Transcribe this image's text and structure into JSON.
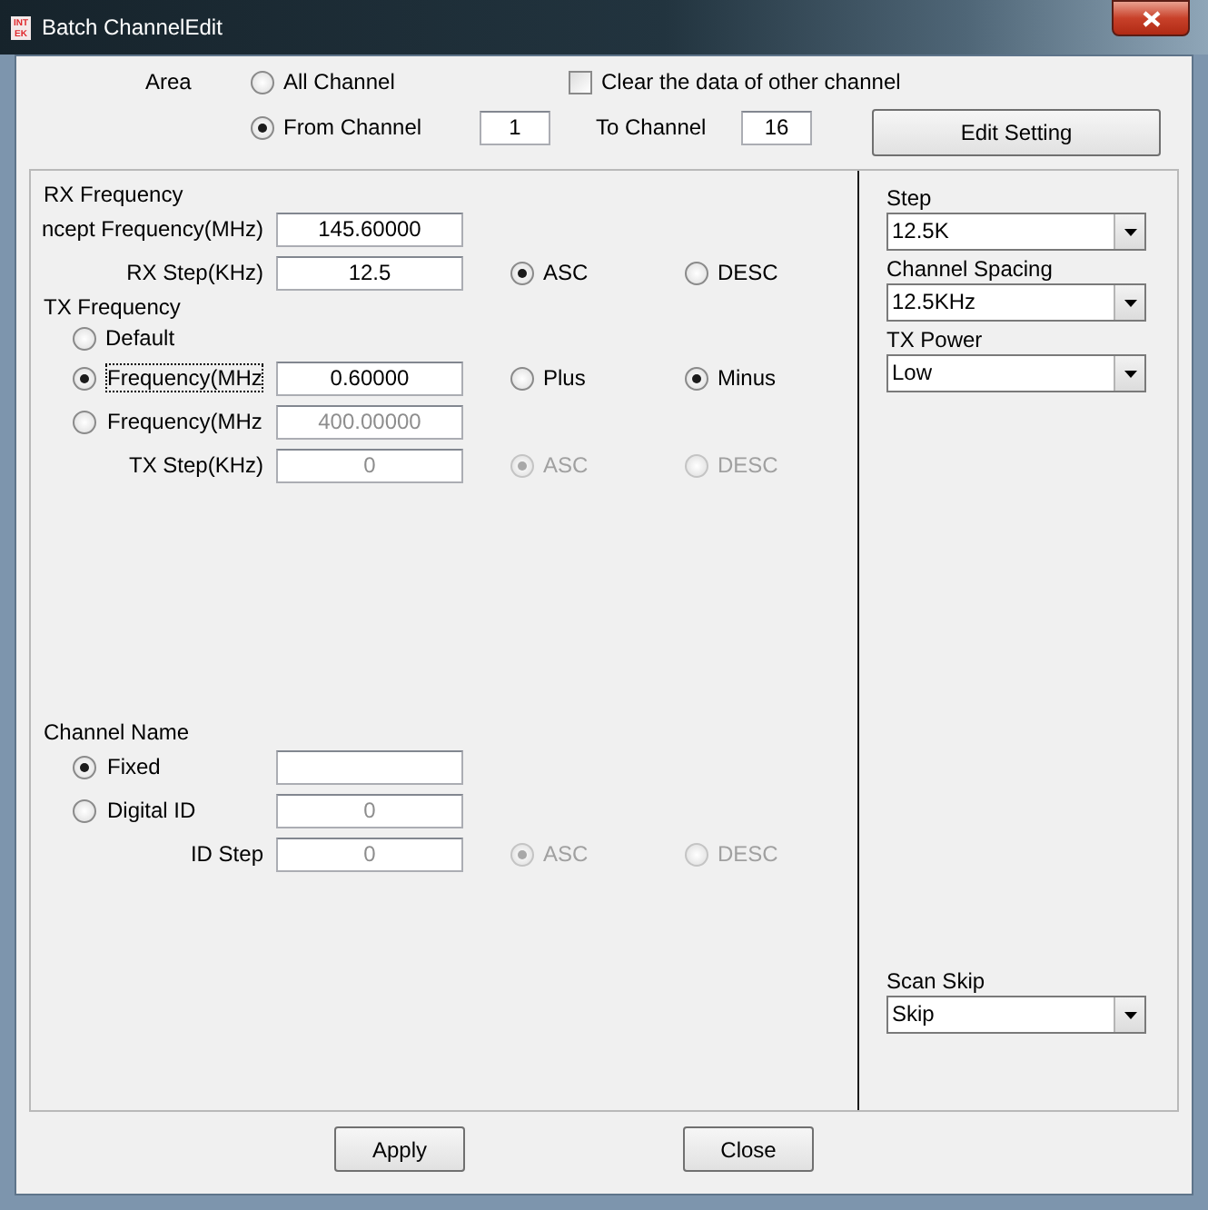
{
  "window": {
    "title": "Batch ChannelEdit",
    "icon_text": [
      "INT",
      "EK"
    ]
  },
  "area": {
    "label": "Area",
    "options": [
      {
        "label": "All Channel",
        "selected": false
      },
      {
        "label": "From Channel",
        "selected": true
      }
    ],
    "clear_other": {
      "label": "Clear the data of other channel",
      "checked": false
    },
    "from_value": "1",
    "to_label": "To Channel",
    "to_value": "16",
    "edit_button": "Edit Setting"
  },
  "sections": [
    {
      "rows": [
        {
          "kind": "heading",
          "text": "RX Frequency"
        },
        {
          "kind": "field",
          "label": "ncept Frequency(MHz)",
          "value": "145.60000",
          "disabled": false
        },
        {
          "kind": "field",
          "label": "RX Step(KHz)",
          "value": "12.5",
          "disabled": false,
          "options": [
            {
              "label": "ASC",
              "selected": true,
              "disabled": false
            },
            {
              "label": "DESC",
              "selected": false,
              "disabled": false
            }
          ]
        },
        {
          "kind": "heading",
          "text": "TX Frequency"
        },
        {
          "kind": "radio",
          "label": "Default",
          "selected": false
        },
        {
          "kind": "radio_field",
          "label": "Frequency(MHz",
          "selected": true,
          "focused": true,
          "value": "0.60000",
          "disabled": false,
          "options": [
            {
              "label": "Plus",
              "selected": false,
              "disabled": false
            },
            {
              "label": "Minus",
              "selected": true,
              "disabled": false
            }
          ]
        },
        {
          "kind": "radio_field",
          "label": "Frequency(MHz",
          "selected": false,
          "focused": false,
          "value": "400.00000",
          "disabled": true
        },
        {
          "kind": "field",
          "label": "TX Step(KHz)",
          "value": "0",
          "disabled": true,
          "options": [
            {
              "label": "ASC",
              "selected": true,
              "disabled": true
            },
            {
              "label": "DESC",
              "selected": false,
              "disabled": true
            }
          ]
        }
      ]
    },
    {
      "rows": [
        {
          "kind": "heading",
          "text": "Channel Name"
        },
        {
          "kind": "radio_field",
          "label": "Fixed",
          "selected": true,
          "focused": false,
          "disabled": false
        },
        {
          "kind": "radio_field",
          "label": "Digital ID",
          "selected": false,
          "focused": false,
          "value": "0",
          "disabled": true
        },
        {
          "kind": "field",
          "label": "ID Step",
          "value": "0",
          "disabled": true,
          "options": [
            {
              "label": "ASC",
              "selected": true,
              "disabled": true
            },
            {
              "label": "DESC",
              "selected": false,
              "disabled": true
            }
          ]
        }
      ]
    }
  ],
  "settings": [
    {
      "label": "Step",
      "value": "12.5K"
    },
    {
      "label": "Channel Spacing",
      "value": "12.5KHz"
    },
    {
      "label": "TX Power",
      "value": "Low"
    }
  ],
  "bottom_settings": [
    {
      "label": "Scan Skip",
      "value": "Skip"
    }
  ],
  "buttons": [
    "Apply",
    "Close"
  ]
}
